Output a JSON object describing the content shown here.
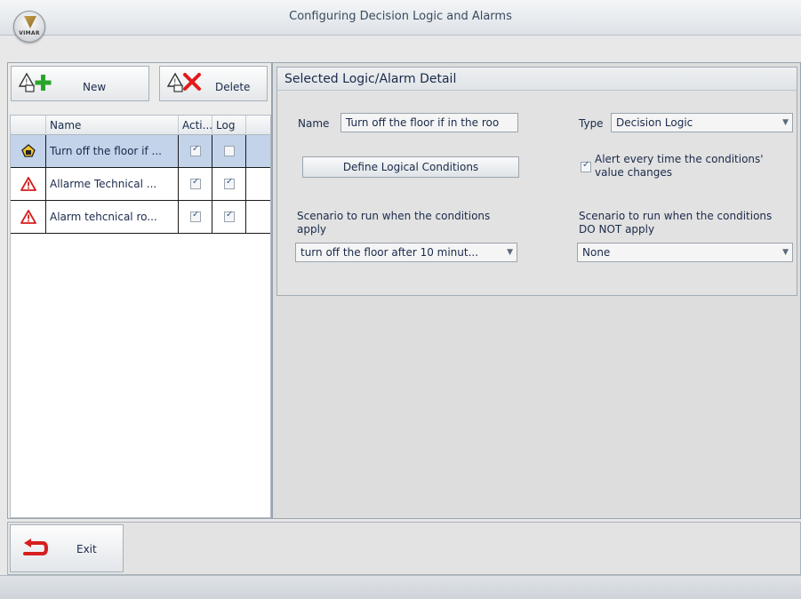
{
  "window": {
    "title": "Configuring Decision Logic and Alarms",
    "logo_text": "VIMAR"
  },
  "toolbar": {
    "new_label": "New",
    "delete_label": "Delete"
  },
  "grid": {
    "columns": [
      "Name",
      "Acti...",
      "Log"
    ],
    "rows": [
      {
        "icon": "decision-logic-icon",
        "name": "Turn off the floor if ...",
        "active": true,
        "log": false,
        "selected": true
      },
      {
        "icon": "alarm-warning-icon",
        "name": "Allarme Technical ...",
        "active": true,
        "log": true,
        "selected": false
      },
      {
        "icon": "alarm-warning-icon",
        "name": "Alarm tehcnical ro...",
        "active": true,
        "log": true,
        "selected": false
      }
    ]
  },
  "detail": {
    "title": "Selected Logic/Alarm Detail",
    "name_label": "Name",
    "name_value": "Turn off the floor if in the roo",
    "type_label": "Type",
    "type_value": "Decision Logic",
    "define_button": "Define Logical Conditions",
    "alert_checkbox_line1": "Alert every time the conditions'",
    "alert_checkbox_line2": "value changes",
    "alert_checked": true,
    "scenario_apply_line1": "Scenario to run when the conditions",
    "scenario_apply_line2": "apply",
    "scenario_apply_value": "turn off the floor after 10 minut...",
    "scenario_not_apply_line1": "Scenario to run when the conditions",
    "scenario_not_apply_line2": "DO NOT apply",
    "scenario_not_apply_value": "None"
  },
  "footer": {
    "exit_label": "Exit"
  },
  "colors": {
    "accent_green": "#2aa52a",
    "delete_red": "#e11b1b",
    "exit_red": "#d61e1e",
    "selected_row": "#c2d3ea"
  }
}
